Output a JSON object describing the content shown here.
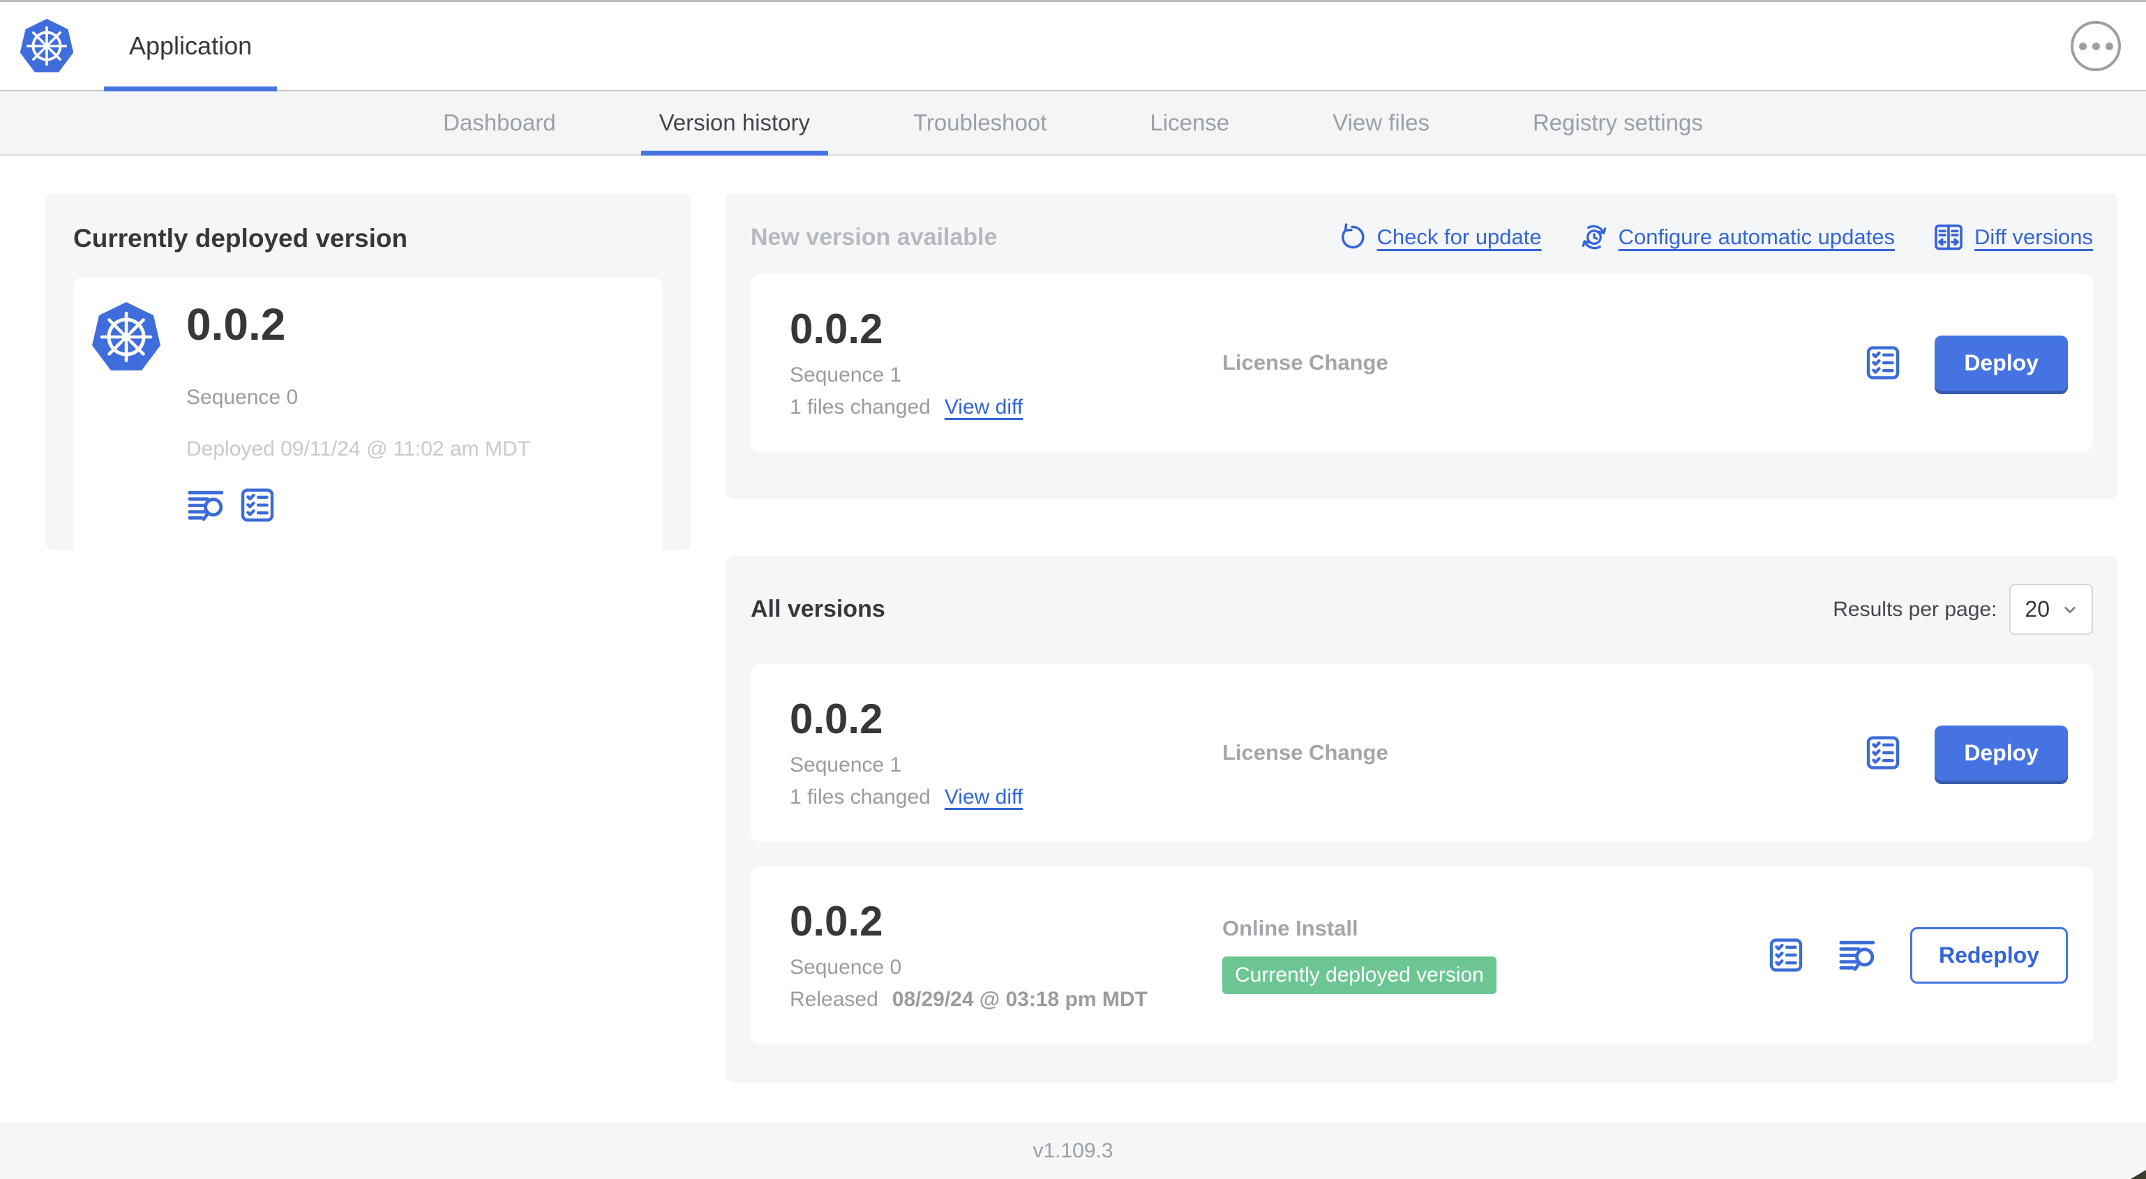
{
  "header": {
    "app_tab_label": "Application"
  },
  "nav_tabs": [
    {
      "label": "Dashboard"
    },
    {
      "label": "Version history"
    },
    {
      "label": "Troubleshoot"
    },
    {
      "label": "License"
    },
    {
      "label": "View files"
    },
    {
      "label": "Registry settings"
    }
  ],
  "current_version_panel": {
    "title": "Currently deployed version",
    "version": "0.0.2",
    "sequence": "Sequence 0",
    "deployed": "Deployed 09/11/24 @ 11:02 am MDT"
  },
  "new_version_panel": {
    "title": "New version available",
    "check_for_update": "Check for update",
    "configure_auto_updates": "Configure automatic updates",
    "diff_versions": "Diff versions",
    "row": {
      "version": "0.0.2",
      "sequence": "Sequence 1",
      "files_changed": "1 files changed",
      "view_diff": "View diff",
      "source": "License Change",
      "deploy_label": "Deploy"
    }
  },
  "all_versions_panel": {
    "title": "All versions",
    "results_per_page_label": "Results per page:",
    "results_per_page_value": "20",
    "row1": {
      "version": "0.0.2",
      "sequence": "Sequence 1",
      "files_changed": "1 files changed",
      "view_diff": "View diff",
      "source": "License Change",
      "deploy_label": "Deploy"
    },
    "row2": {
      "version": "0.0.2",
      "sequence": "Sequence 0",
      "released_prefix": "Released",
      "released_date": "08/29/24 @ 03:18 pm MDT",
      "source": "Online Install",
      "badge": "Currently deployed version",
      "redeploy_label": "Redeploy"
    }
  },
  "footer": {
    "app_version": "v1.109.3"
  },
  "colors": {
    "primary_blue": "#4574e2",
    "link_blue": "#3465d8",
    "badge_green": "#6cc694",
    "panel_gray": "#f4f6f8",
    "muted_text": "#9c9c9c",
    "faint_text": "#c6cacc"
  }
}
